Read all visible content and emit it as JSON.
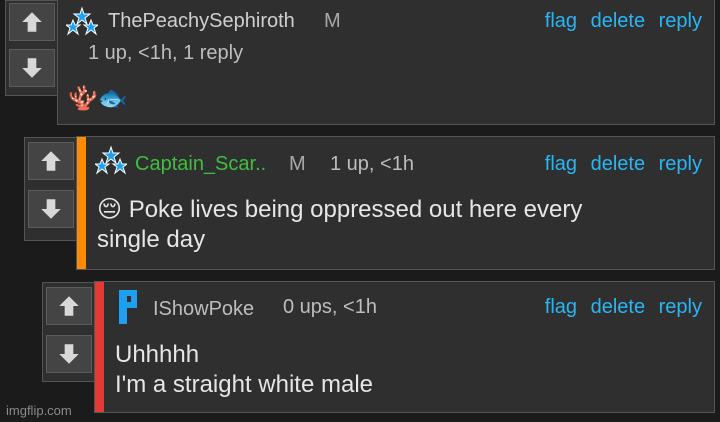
{
  "comments": [
    {
      "username": "ThePeachySephiroth",
      "mod": "M",
      "meta": "1 up, <1h, 1 reply",
      "body": "🪸🐟",
      "username_color": "#cfcfcf",
      "accent_color": ""
    },
    {
      "username": "Captain_Scar..",
      "mod": "M",
      "meta": "1 up, <1h",
      "emoji": "😔",
      "body": "Poke lives being oppressed out here every",
      "body_line2": "single day",
      "username_color": "#3fbf3f",
      "accent_color": "#ff8c00"
    },
    {
      "username": "IShowPoke",
      "mod": "",
      "meta": "0 ups, <1h",
      "body": "Uhhhhh",
      "body_line2": "I'm a straight white male",
      "username_color": "#bdbdbd",
      "accent_color": "#e53935"
    }
  ],
  "actions": {
    "flag": "flag",
    "delete": "delete",
    "reply": "reply"
  },
  "watermark": "imgflip.com",
  "colors": {
    "link": "#29b6f6",
    "badge": "#1e9ff0"
  }
}
